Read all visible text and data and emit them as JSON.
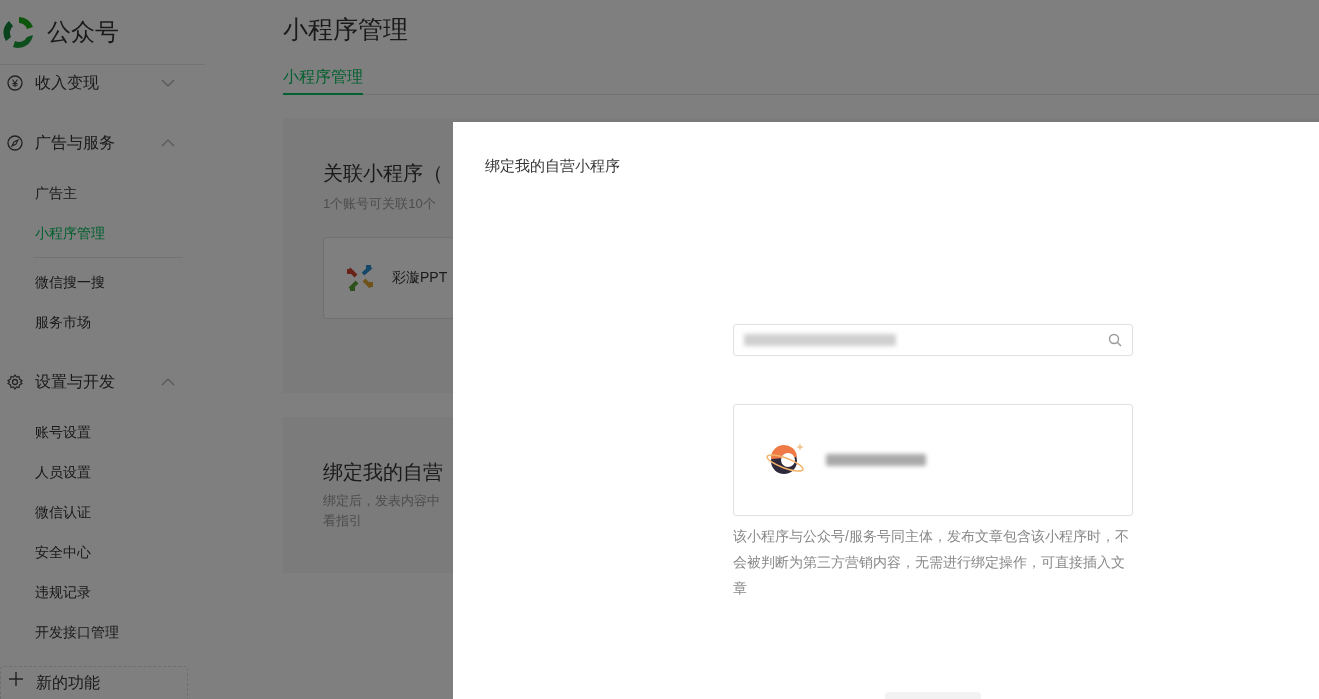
{
  "header": {
    "brand": "公众号"
  },
  "sidebar": {
    "groups": [
      {
        "label": "收入变现",
        "kind": "yen",
        "expanded": false
      },
      {
        "label": "广告与服务",
        "kind": "compass",
        "expanded": true,
        "items": [
          {
            "label": "广告主",
            "selected": false
          },
          {
            "label": "小程序管理",
            "selected": true
          },
          {
            "kind": "divider"
          },
          {
            "label": "微信搜一搜",
            "selected": false
          },
          {
            "label": "服务市场",
            "selected": false
          }
        ]
      },
      {
        "label": "设置与开发",
        "kind": "gear",
        "expanded": true,
        "items": [
          {
            "label": "账号设置",
            "selected": false
          },
          {
            "label": "人员设置",
            "selected": false
          },
          {
            "label": "微信认证",
            "selected": false
          },
          {
            "label": "安全中心",
            "selected": false
          },
          {
            "label": "违规记录",
            "selected": false
          },
          {
            "label": "开发接口管理",
            "selected": false
          }
        ]
      }
    ],
    "new_feature": {
      "label": "新的功能"
    }
  },
  "main": {
    "title": "小程序管理",
    "tabs": [
      {
        "label": "小程序管理",
        "selected": true
      }
    ],
    "linked_card": {
      "title": "关联小程序（",
      "subtitle": "1个账号可关联10个",
      "app": {
        "name": "彩漩PPT"
      }
    },
    "bind_card": {
      "title": "绑定我的自营",
      "description": [
        "绑定后，发表内容中",
        "看指引"
      ]
    }
  },
  "modal": {
    "title": "绑定我的自营小程序",
    "note": "该小程序与公众号/服务号同主体，发布文章包含该小程序时，不会被判断为第三方营销内容，无需进行绑定操作，可直接插入文章"
  }
}
